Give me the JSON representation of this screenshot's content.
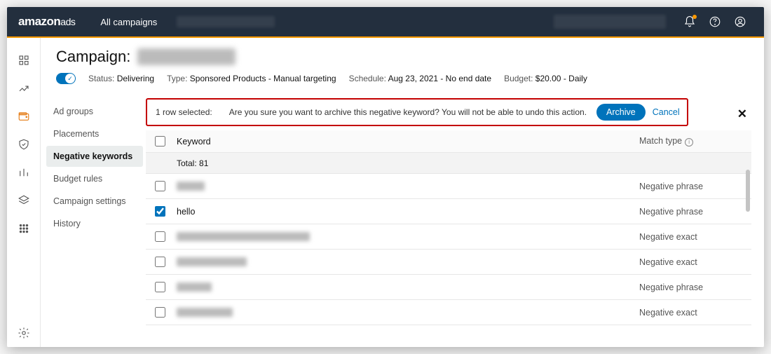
{
  "header": {
    "logo_main": "amazon",
    "logo_sub": "ads",
    "all_campaigns": "All campaigns"
  },
  "campaign": {
    "title_prefix": "Campaign:",
    "status_label": "Status:",
    "status_value": "Delivering",
    "type_label": "Type:",
    "type_value": "Sponsored Products - Manual targeting",
    "schedule_label": "Schedule:",
    "schedule_value": "Aug 23, 2021 - No end date",
    "budget_label": "Budget:",
    "budget_value": "$20.00 - Daily"
  },
  "tabs": {
    "ad_groups": "Ad groups",
    "placements": "Placements",
    "negative_keywords": "Negative keywords",
    "budget_rules": "Budget rules",
    "campaign_settings": "Campaign settings",
    "history": "History"
  },
  "confirm": {
    "rows_selected": "1 row selected:",
    "message": "Are you sure you want to archive this negative keyword? You will not be able to undo this action.",
    "archive": "Archive",
    "cancel": "Cancel"
  },
  "table": {
    "col_keyword": "Keyword",
    "col_match": "Match type",
    "total_label": "Total: 81",
    "rows": [
      {
        "keyword": "",
        "match": "Negative phrase",
        "checked": false,
        "blur_w": 40
      },
      {
        "keyword": "hello",
        "match": "Negative phrase",
        "checked": true
      },
      {
        "keyword": "",
        "match": "Negative exact",
        "checked": false,
        "blur_w": 190
      },
      {
        "keyword": "",
        "match": "Negative exact",
        "checked": false,
        "blur_w": 100
      },
      {
        "keyword": "",
        "match": "Negative phrase",
        "checked": false,
        "blur_w": 50
      },
      {
        "keyword": "",
        "match": "Negative exact",
        "checked": false,
        "blur_w": 80
      }
    ]
  }
}
